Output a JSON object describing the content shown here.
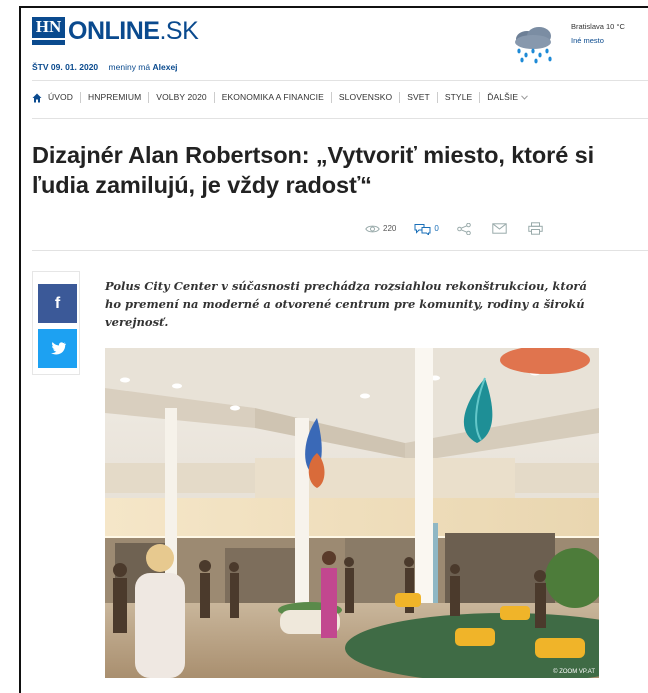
{
  "brand": {
    "logo_mark": "HN",
    "logo_name": "ONLINE",
    "logo_tld": ".SK",
    "color": "#0a4a8e"
  },
  "dateline": {
    "date": "ŠTV 09. 01. 2020",
    "nameday_prefix": "meniny má",
    "nameday_name": "Alexej"
  },
  "weather": {
    "location": "Bratislava 10 °C",
    "other_city_link": "Iné mesto",
    "icon": "rain-cloud-icon"
  },
  "nav": {
    "items": [
      {
        "label": "ÚVOD",
        "icon": "home-icon"
      },
      {
        "label": "HNPREMIUM"
      },
      {
        "label": "VOLBY 2020"
      },
      {
        "label": "EKONOMIKA A FINANCIE"
      },
      {
        "label": "SLOVENSKO"
      },
      {
        "label": "SVET"
      },
      {
        "label": "STYLE"
      },
      {
        "label": "ĎALŠIE",
        "icon": "chevron-down-icon"
      }
    ]
  },
  "article": {
    "headline": "Dizajnér Alan Robertson: „Vytvoriť miesto, ktoré si ľudia zamilujú, je vždy radosť“",
    "views": "220",
    "comments": "0",
    "lead": "Polus City Center v súčasnosti prechádza rozsiahlou rekonštrukciou, ktorá ho premení na moderné a otvorené centrum pre komunity, rodiny a širokú verejnosť.",
    "photo_credit": "© ZOOM VP.AT"
  },
  "share": {
    "facebook_label": "f",
    "facebook_color": "#3b5998",
    "twitter_color": "#1da1f2"
  }
}
